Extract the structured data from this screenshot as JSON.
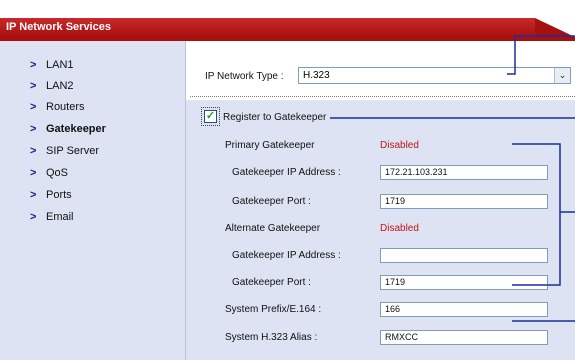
{
  "window": {
    "title": "IP Network Services"
  },
  "sidebar": {
    "items": [
      {
        "label": "LAN1"
      },
      {
        "label": "LAN2"
      },
      {
        "label": "Routers"
      },
      {
        "label": "Gatekeeper",
        "active": true
      },
      {
        "label": "SIP Server"
      },
      {
        "label": "QoS"
      },
      {
        "label": "Ports"
      },
      {
        "label": "Email"
      }
    ]
  },
  "form": {
    "network_type_label": "IP Network Type :",
    "network_type_value": "H.323",
    "register_label": "Register to Gatekeeper",
    "register_checked": true,
    "primary": {
      "title": "Primary Gatekeeper",
      "status": "Disabled",
      "ip_label": "Gatekeeper IP Address :",
      "ip_value": "172.21.103.231",
      "port_label": "Gatekeeper Port :",
      "port_value": "1719"
    },
    "alternate": {
      "title": "Alternate Gatekeeper",
      "status": "Disabled",
      "ip_label": "Gatekeeper IP Address :",
      "ip_value": "",
      "port_label": "Gatekeeper Port :",
      "port_value": "1719"
    },
    "prefix_label": "System Prefix/E.164 :",
    "prefix_value": "166",
    "alias_label": "System H.323 Alias :",
    "alias_value": "RMXCC"
  },
  "icons": {
    "nav_chevron": "chevron-right-icon",
    "dropdown": "chevron-down-icon",
    "check": "checkmark-icon"
  },
  "colors": {
    "title_bar": "#a81010",
    "panel": "#dde3f3",
    "status_red": "#c01515",
    "callout_line": "#1a2ea0"
  }
}
